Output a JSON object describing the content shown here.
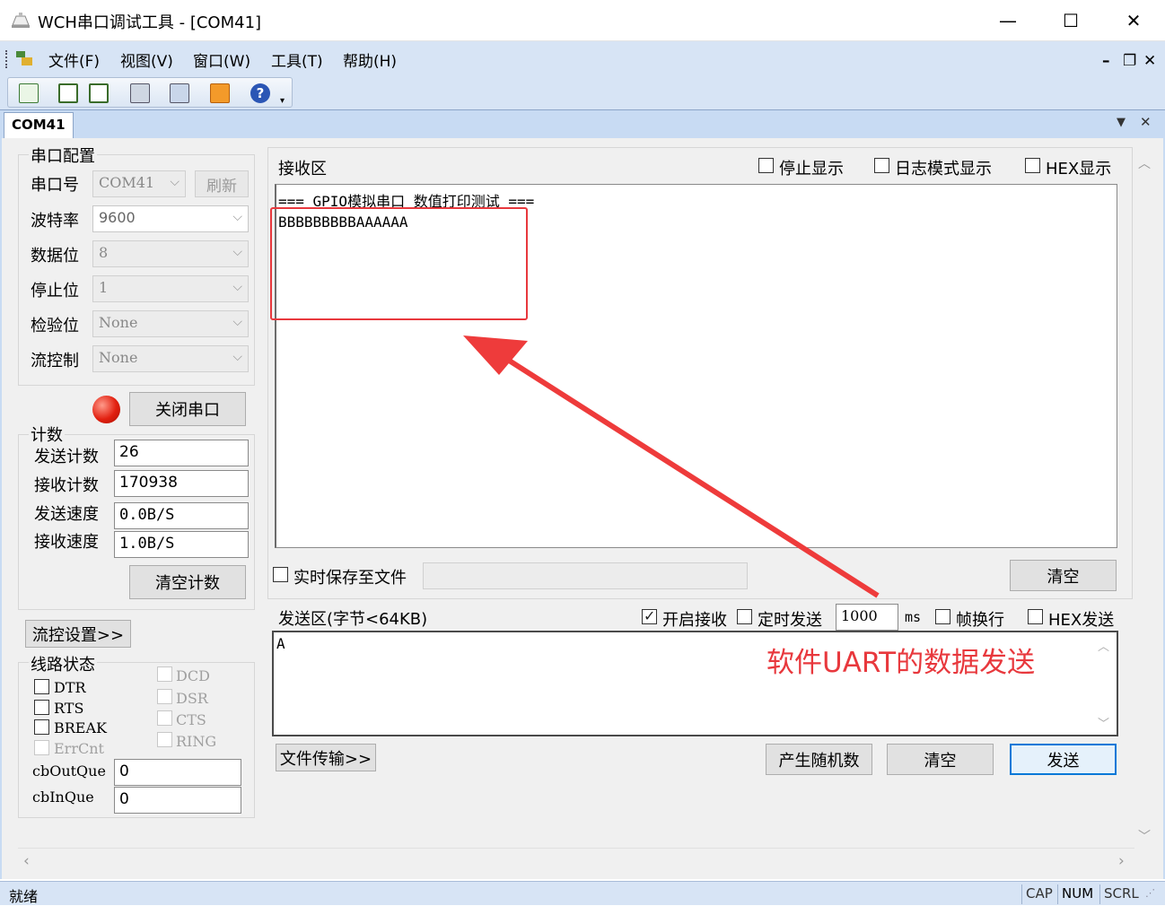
{
  "window": {
    "title": "WCH串口调试工具 - [COM41]",
    "min": "—",
    "max": "☐",
    "close": "✕"
  },
  "menu": [
    "文件(F)",
    "视图(V)",
    "窗口(W)",
    "工具(T)",
    "帮助(H)"
  ],
  "mdi_controls": {
    "min": "–",
    "restore": "❐",
    "close": "✕"
  },
  "tab": {
    "label": "COM41",
    "dropdown": "▼",
    "close": "✕"
  },
  "serial_config": {
    "group_title": "串口配置",
    "port_label": "串口号",
    "port_value": "COM41",
    "refresh_label": "刷新",
    "baud_label": "波特率",
    "baud_value": "9600",
    "databits_label": "数据位",
    "databits_value": "8",
    "stopbits_label": "停止位",
    "stopbits_value": "1",
    "parity_label": "检验位",
    "parity_value": "None",
    "flow_label": "流控制",
    "flow_value": "None",
    "close_port_label": "关闭串口"
  },
  "counts": {
    "group_title": "计数",
    "send_count_label": "发送计数",
    "send_count_value": "26",
    "recv_count_label": "接收计数",
    "recv_count_value": "170938",
    "send_speed_label": "发送速度",
    "send_speed_value": "0.0B/S",
    "recv_speed_label": "接收速度",
    "recv_speed_value": "1.0B/S",
    "clear_count_label": "清空计数"
  },
  "flow_settings_label": "流控设置>>",
  "line_status": {
    "group_title": "线路状态",
    "dtr": "DTR",
    "rts": "RTS",
    "break": "BREAK",
    "errcnt": "ErrCnt",
    "dcd": "DCD",
    "dsr": "DSR",
    "cts": "CTS",
    "ring": "RING",
    "cboutque_label": "cbOutQue",
    "cboutque_value": "0",
    "cbinque_label": "cbInQue",
    "cbinque_value": "0"
  },
  "receive": {
    "title": "接收区",
    "stop_display": "停止显示",
    "log_mode": "日志模式显示",
    "hex_display": "HEX显示",
    "line1": "=== GPIO模拟串口 数值打印测试 ===",
    "line2": "BBBBBBBBBAAAAAA",
    "save_to_file": "实时保存至文件",
    "clear": "清空"
  },
  "send": {
    "title": "发送区(字节<64KB)",
    "enable_receive": "开启接收",
    "enable_receive_checked": true,
    "timed_send": "定时发送",
    "interval": "1000",
    "unit": "ms",
    "newline": "帧换行",
    "hex_send": "HEX发送",
    "content": "A",
    "annotation": "软件UART的数据发送",
    "file_transfer": "文件传输>>",
    "random": "产生随机数",
    "clear": "清空",
    "send": "发送"
  },
  "status": {
    "ready": "就绪",
    "cap": "CAP",
    "num": "NUM",
    "scrl": "SCRL"
  },
  "colors": {
    "annotation_red": "#e8383d",
    "chrome_blue": "#d7e4f5"
  }
}
